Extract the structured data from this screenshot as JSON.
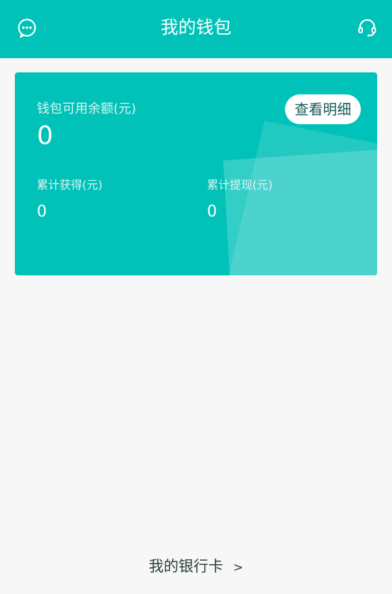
{
  "header": {
    "title": "我的钱包",
    "left_icon": "message-dots-icon",
    "right_icon": "headset-icon"
  },
  "wallet": {
    "balance_label": "钱包可用余额(元)",
    "balance_value": "0",
    "detail_button": "查看明细",
    "earned_label": "累计获得(元)",
    "earned_value": "0",
    "withdrawn_label": "累计提现(元)",
    "withdrawn_value": "0"
  },
  "footer": {
    "bank_card_label": "我的银行卡",
    "chevron": ">"
  },
  "colors": {
    "accent": "#00c2b8",
    "background": "#f7f7f7"
  }
}
